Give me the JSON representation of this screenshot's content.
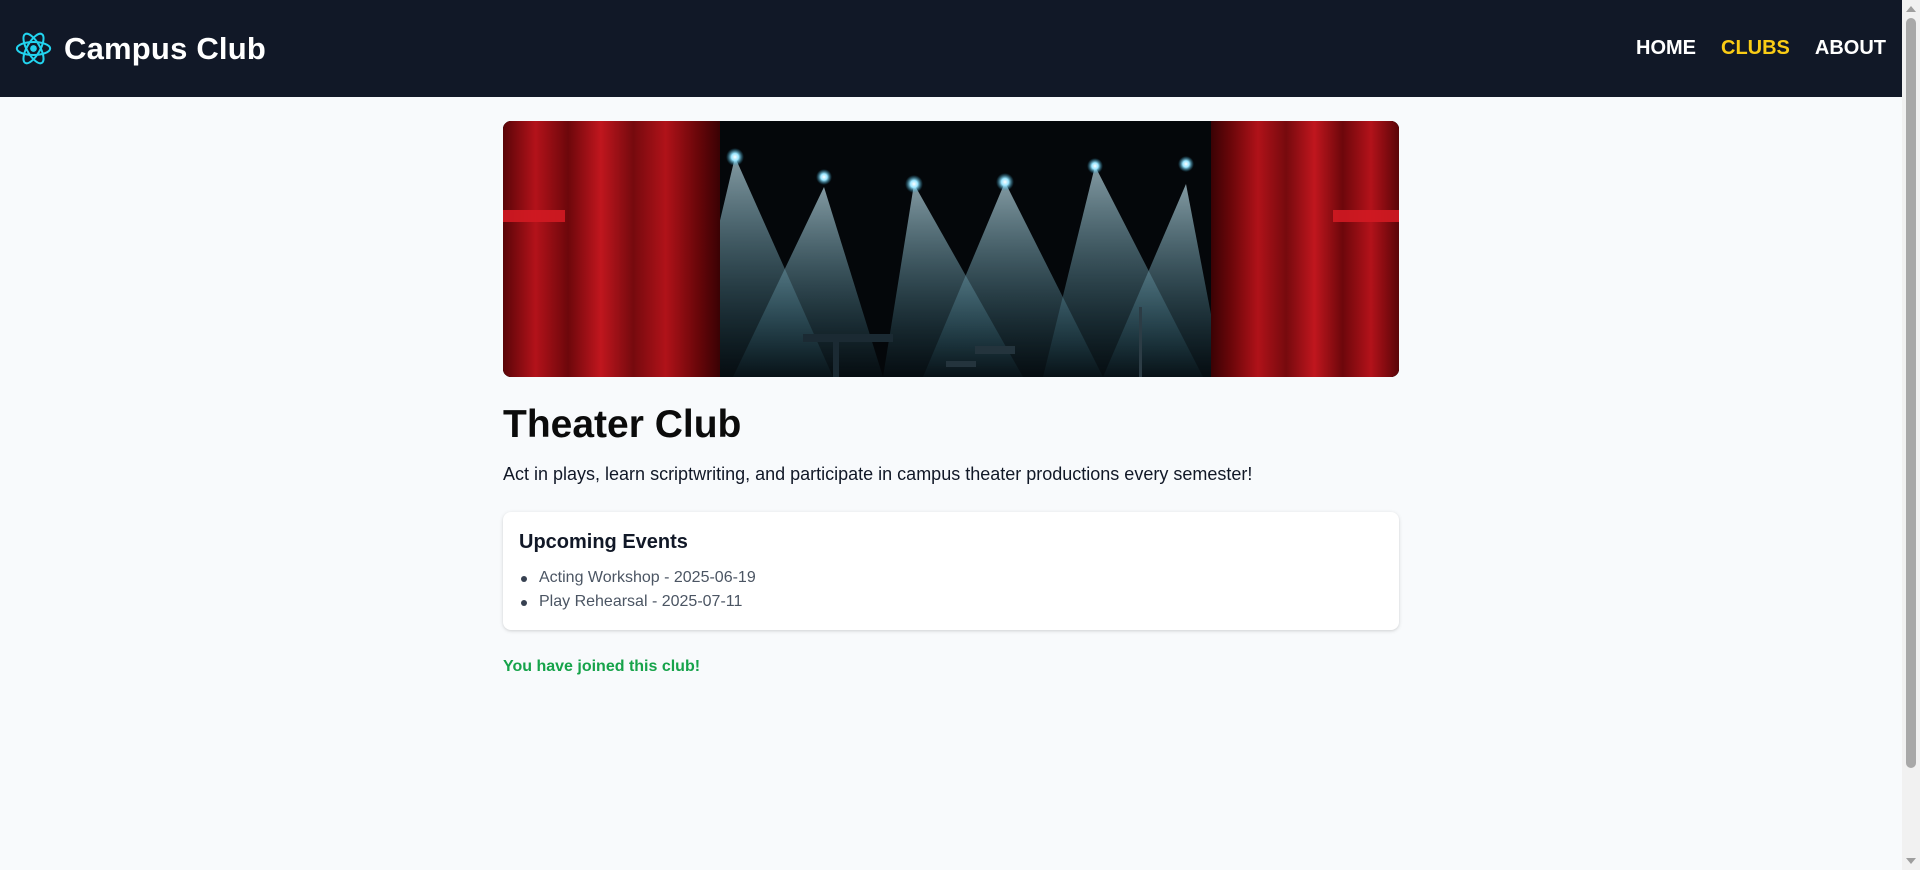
{
  "header": {
    "brand_icon": "react-atom-icon",
    "brand_title": "Campus Club",
    "nav": [
      {
        "label": "HOME",
        "active": false
      },
      {
        "label": "CLUBS",
        "active": true
      },
      {
        "label": "ABOUT",
        "active": false
      }
    ],
    "accent_color": "#facc15",
    "background_color": "#111827"
  },
  "club": {
    "banner_image": "theater-stage-curtains-spotlights",
    "name": "Theater Club",
    "description": "Act in plays, learn scriptwriting, and participate in campus theater productions every semester!",
    "events_heading": "Upcoming Events",
    "events": [
      "Acting Workshop - 2025-06-19",
      "Play Rehearsal - 2025-07-11"
    ],
    "status_message": "You have joined this club!",
    "status_color": "#16a34a"
  }
}
